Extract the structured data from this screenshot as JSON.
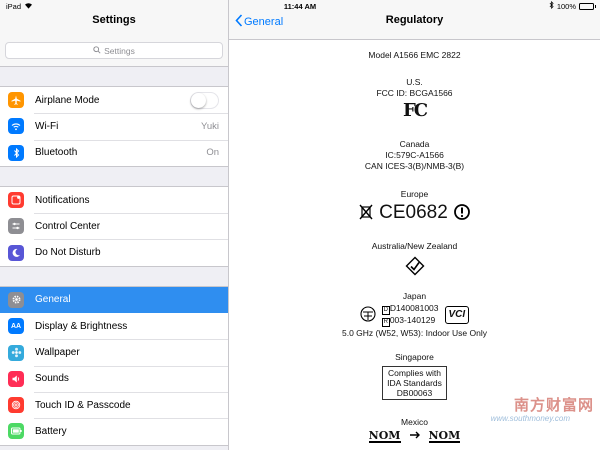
{
  "status": {
    "device": "iPad",
    "time": "11:44 AM",
    "battery": "100%"
  },
  "master": {
    "title": "Settings",
    "search_placeholder": "Settings",
    "groups": [
      [
        {
          "label": "Airplane Mode",
          "icon": "airplane-icon",
          "color": "#ff9500",
          "toggle": false
        },
        {
          "label": "Wi-Fi",
          "icon": "wifi-icon",
          "color": "#007aff",
          "value": "Yuki"
        },
        {
          "label": "Bluetooth",
          "icon": "bluetooth-icon",
          "color": "#007aff",
          "value": "On"
        }
      ],
      [
        {
          "label": "Notifications",
          "icon": "notifications-icon",
          "color": "#ff3b30"
        },
        {
          "label": "Control Center",
          "icon": "control-center-icon",
          "color": "#8e8e93"
        },
        {
          "label": "Do Not Disturb",
          "icon": "moon-icon",
          "color": "#5856d6"
        }
      ],
      [
        {
          "label": "General",
          "icon": "gear-icon",
          "color": "#8e8e93",
          "selected": true
        },
        {
          "label": "Display & Brightness",
          "icon": "display-brightness-icon",
          "color": "#007aff"
        },
        {
          "label": "Wallpaper",
          "icon": "wallpaper-icon",
          "color": "#34aadc"
        },
        {
          "label": "Sounds",
          "icon": "sounds-icon",
          "color": "#ff2d55"
        },
        {
          "label": "Touch ID & Passcode",
          "icon": "fingerprint-icon",
          "color": "#ff3b30"
        },
        {
          "label": "Battery",
          "icon": "battery-icon",
          "color": "#4cd964"
        }
      ]
    ]
  },
  "detail": {
    "back_label": "General",
    "title": "Regulatory",
    "model_line": "Model A1566   EMC 2822",
    "us": {
      "heading": "U.S.",
      "fcc_id": "FCC ID: BCGA1566",
      "logo": "FC"
    },
    "canada": {
      "heading": "Canada",
      "ic": "IC:579C-A1566",
      "can": "CAN ICES-3(B)/NMB-3(B)"
    },
    "europe": {
      "heading": "Europe",
      "mark": "CE0682"
    },
    "anz": {
      "heading": "Australia/New Zealand"
    },
    "japan": {
      "heading": "Japan",
      "line1": "D140081003",
      "line2": "003-140129",
      "note": "5.0 GHz (W52, W53): Indoor Use Only",
      "vcci": "VCI"
    },
    "singapore": {
      "heading": "Singapore",
      "line1": "Complies with",
      "line2": "IDA Standards",
      "line3": "DB00063"
    },
    "mexico": {
      "heading": "Mexico",
      "nom": "NOM"
    }
  },
  "watermark": {
    "text": "南方财富网",
    "sub": "www.southmoney.com"
  }
}
